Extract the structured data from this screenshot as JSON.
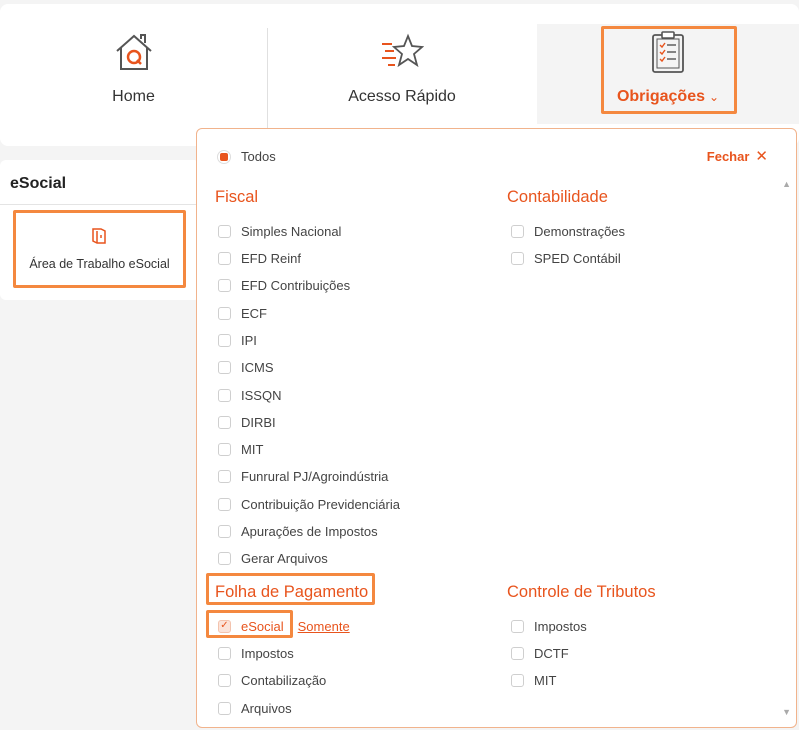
{
  "nav": {
    "home": {
      "label": "Home",
      "icon": "home-icon"
    },
    "acesso": {
      "label": "Acesso Rápido",
      "icon": "star-icon"
    },
    "obrigacoes": {
      "label": "Obrigações",
      "chevron": "⌄",
      "icon": "clipboard-icon"
    }
  },
  "side_panel": {
    "title": "eSocial",
    "card_label": "Área de Trabalho eSocial",
    "card_icon": "book-icon"
  },
  "dropdown": {
    "todos_label": "Todos",
    "close_label": "Fechar",
    "close_icon": "✕",
    "sections": {
      "fiscal": {
        "title": "Fiscal",
        "items": [
          "Simples Nacional",
          "EFD Reinf",
          "EFD Contribuições",
          "ECF",
          "IPI",
          "ICMS",
          "ISSQN",
          "DIRBI",
          "MIT",
          "Funrural PJ/Agroindústria",
          "Contribuição Previdenciária",
          "Apurações de Impostos",
          "Gerar Arquivos"
        ]
      },
      "contabilidade": {
        "title": "Contabilidade",
        "items": [
          "Demonstrações",
          "SPED Contábil"
        ]
      },
      "folha": {
        "title": "Folha de Pagamento",
        "items": [
          "eSocial",
          "Impostos",
          "Contabilização",
          "Arquivos"
        ],
        "somente_label": "Somente"
      },
      "controle": {
        "title": "Controle de Tributos",
        "items": [
          "Impostos",
          "DCTF",
          "MIT"
        ]
      }
    }
  },
  "colors": {
    "accent": "#e8541d",
    "highlight": "#f4883f"
  }
}
